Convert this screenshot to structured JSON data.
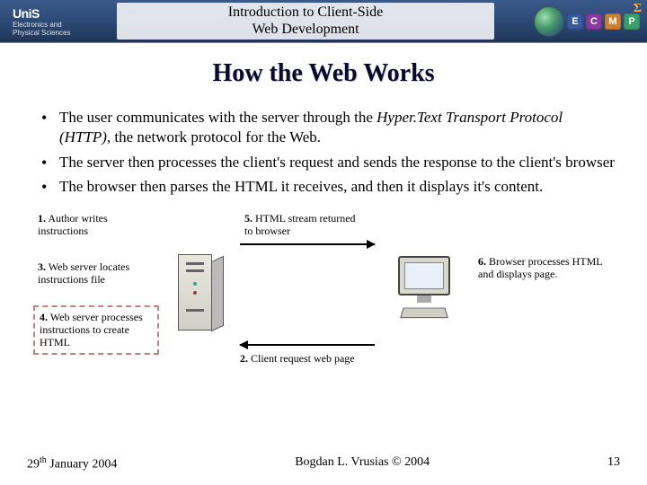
{
  "header": {
    "logo_main": "UniS",
    "logo_sub1": "Electronics and",
    "logo_sub2": "Physical Sciences",
    "title_line1": "Introduction to Client-Side",
    "title_line2": "Web Development",
    "badges": [
      "E",
      "C",
      "M",
      "P"
    ],
    "sigma": "Σ"
  },
  "slide_title": "How the Web Works",
  "bullets": [
    {
      "prefix": "The user communicates with the server through the ",
      "italic": "Hyper.Text Transport Protocol (HTTP)",
      "suffix": ", the network protocol for the Web."
    },
    {
      "text": "The server then processes the client's request and sends the response to the client's browser"
    },
    {
      "text": "The browser then parses the HTML it receives, and then it displays it's content."
    }
  ],
  "steps": {
    "s1": {
      "num": "1.",
      "text": "Author writes instructions"
    },
    "s2": {
      "num": "2.",
      "text": "Client request web page"
    },
    "s3": {
      "num": "3.",
      "text": "Web server locates instructions file"
    },
    "s4": {
      "num": "4.",
      "text": "Web server processes instructions to create HTML"
    },
    "s5": {
      "num": "5.",
      "text": "HTML stream returned to browser"
    },
    "s6": {
      "num": "6.",
      "text": "Browser processes HTML and displays page."
    }
  },
  "footer": {
    "date_day": "29",
    "date_sup": "th",
    "date_rest": " January 2004",
    "center": "Bogdan L. Vrusias © 2004",
    "page": "13"
  }
}
